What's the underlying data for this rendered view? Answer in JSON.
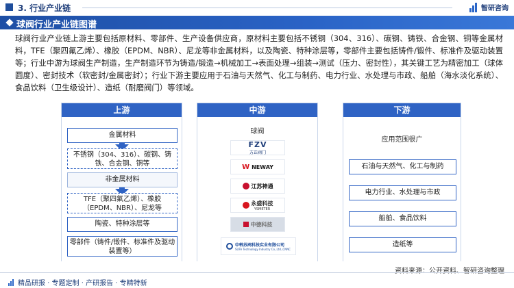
{
  "header": {
    "section": "3. 行业产业链",
    "brand": "智研咨询",
    "title": "球阀行业产业链图谱"
  },
  "intro": "球阀行业产业链上游主要包括原材料、零部件、生产设备供应商，原材料主要包括不锈钢（304、316）、碳钢、铸铁、合金钢、铜等金属材料，TFE（聚四氟乙烯）、橡胶（EPDM、NBR）、尼龙等非金属材料，以及陶瓷、特种涂层等，零部件主要包括铸件/锻件、标准件及驱动装置等；行业中游为球阀生产制造，生产制造环节为铸造/锻造→机械加工→表面处理→组装→测试（压力、密封性），其关键工艺为精密加工（球体圆度）、密封技术（软密封/金属密封）；行业下游主要应用于石油与天然气、化工与制药、电力行业、水处理与市政、船舶（海水淡化系统）、食品饮料（卫生级设计）、造纸（耐磨阀门）等领域。",
  "upstream": {
    "heading": "上游",
    "metal_title": "金属材料",
    "metal_items": "不锈钢（304、316）、碳钢、铸铁、合金钢、铜等",
    "nonmetal_title": "非金属材料",
    "nonmetal_items": "TFE（聚四氟乙烯）、橡胶（EPDM、NBR）、尼龙等",
    "ceramic": "陶瓷、特种涂层等",
    "parts": "零部件（铸件/锻件、标准件及驱动装置等）"
  },
  "midstream": {
    "heading": "中游",
    "label": "球阀",
    "logos": [
      {
        "name": "FZV",
        "sub": "方正阀门"
      },
      {
        "name": "NEWAY"
      },
      {
        "name": "江苏神通"
      },
      {
        "name": "永盛科技",
        "sub": "YSMETER"
      },
      {
        "name": "中德科技"
      },
      {
        "name": "中韩苏阀科技实业有限公司",
        "sub": "SUFA Technology Industry Co.,Ltd.,CNNC"
      }
    ]
  },
  "downstream": {
    "heading": "下游",
    "label": "应用范围很广",
    "items": [
      "石油与天然气、化工与制药",
      "电力行业、水处理与市政",
      "船舶、食品饮料",
      "造纸等"
    ]
  },
  "footer": {
    "tagline": "精品研报 · 专题定制 · 产研报告 · 专精特新",
    "source": "资料来源：公开资料、智研咨询整理"
  },
  "colors": {
    "primary": "#2f63c4",
    "title_bar": "#1e4fa5",
    "neway_red": "#d8161f",
    "shentong_red": "#c8102e"
  }
}
